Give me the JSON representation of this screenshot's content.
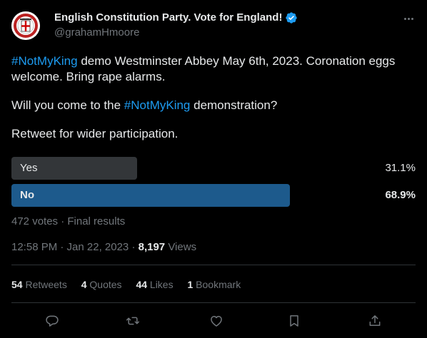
{
  "author": {
    "display_name": "English Constitution Party. Vote for England!",
    "handle": "@grahamHmoore",
    "avatar_icon": "party-crest-icon",
    "verified_icon": "verified-badge-icon",
    "more_icon": "more-options-icon"
  },
  "tweet": {
    "line1_hashtag": "#NotMyKing",
    "line1_text": " demo Westminster Abbey May 6th, 2023.  Coronation eggs welcome.  Bring rape alarms.",
    "line2_prefix": "Will you come to the ",
    "line2_hashtag": "#NotMyKing",
    "line2_suffix": "  demonstration?",
    "line3": "Retweet for wider participation."
  },
  "poll": {
    "options": [
      {
        "label": "Yes",
        "percent_text": "31.1%",
        "share": 0.311,
        "winner": false
      },
      {
        "label": "No",
        "percent_text": "68.9%",
        "share": 0.689,
        "winner": true
      }
    ],
    "meta": "472 votes · Final results",
    "bar_color_winner": "#1d5a8c",
    "bar_color_other": "#333639"
  },
  "timestamp": {
    "time": "12:58 PM · Jan 22, 2023 · ",
    "views_count": "8,197",
    "views_label": " Views"
  },
  "stats": {
    "retweets_count": "54",
    "retweets_label": " Retweets",
    "quotes_count": "4",
    "quotes_label": " Quotes",
    "likes_count": "44",
    "likes_label": " Likes",
    "bookmarks_count": "1",
    "bookmarks_label": " Bookmark"
  },
  "actions": {
    "reply_icon": "reply-icon",
    "retweet_icon": "retweet-icon",
    "like_icon": "heart-icon",
    "bookmark_icon": "bookmark-icon",
    "share_icon": "share-icon"
  },
  "colors": {
    "accent": "#1d9bf0",
    "text": "#e7e9ea",
    "muted": "#71767b",
    "background": "#000000"
  }
}
